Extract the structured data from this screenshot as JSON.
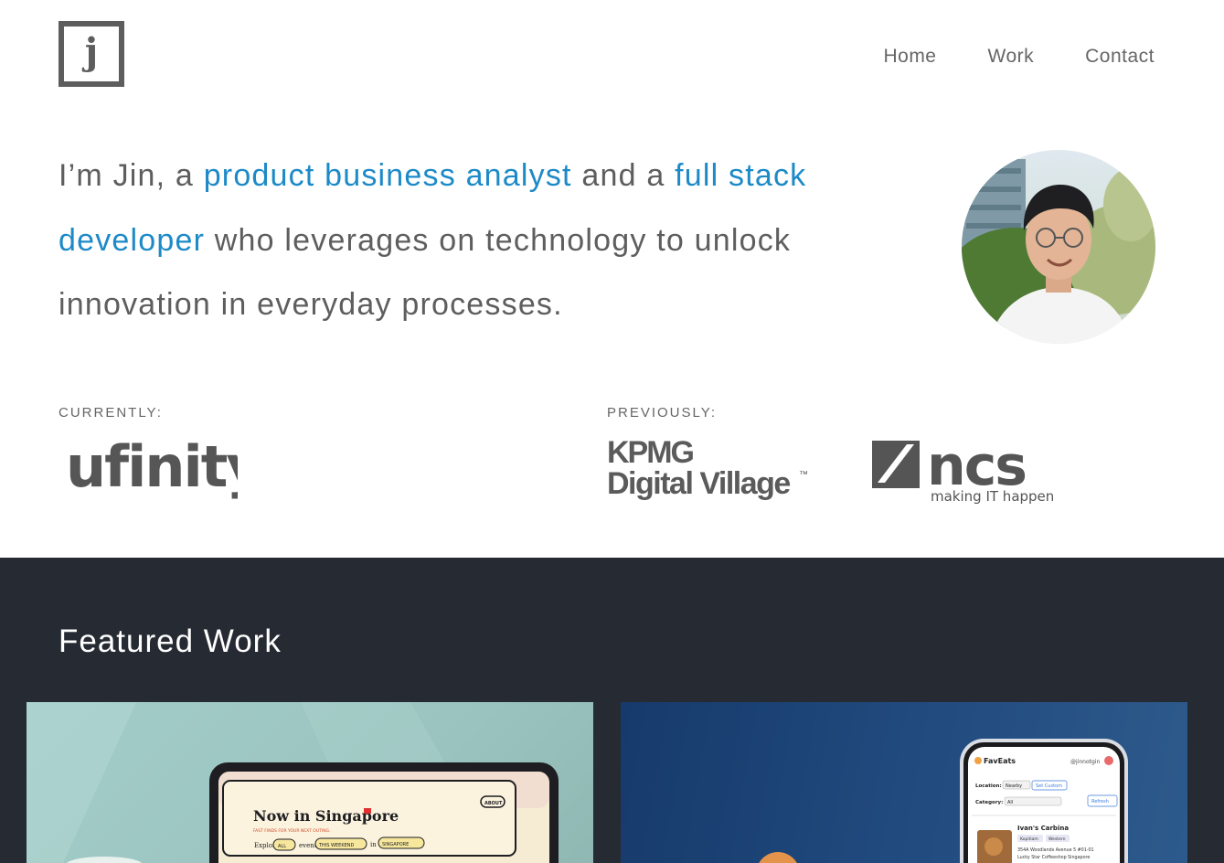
{
  "logo": {
    "letter": "j"
  },
  "nav": {
    "home": "Home",
    "work": "Work",
    "contact": "Contact"
  },
  "intro": {
    "p1": "I’m Jin, a ",
    "h1": "product business analyst",
    "p2": " and a ",
    "h2": "full stack developer",
    "p3": " who leverages on technology to unlock innovation in everyday processes."
  },
  "colors": {
    "accent": "#1d8ac8",
    "dark_section": "#262a33"
  },
  "employers": {
    "currently_label": "CURRENTLY:",
    "previously_label": "PREVIOUSLY:",
    "current": "ufinity",
    "previous": [
      {
        "line1": "KPMG",
        "line2": "Digital Village",
        "tm": "™"
      },
      {
        "name": "ncs",
        "tagline": "making IT happen"
      }
    ]
  },
  "featured": {
    "title": "Featured Work",
    "card1": {
      "headline": "Now in Singapore",
      "subline": "FAST FINDS FOR YOUR NEXT OUTING.",
      "about": "ABOUT",
      "explore": "Explore",
      "filter1": "ALL",
      "events": "events",
      "filter2": "THIS WEEKEND",
      "in": "in",
      "filter3": "SINGAPORE"
    },
    "card2": {
      "app": "FavEats",
      "handle": "@jinnotgin",
      "location_label": "Location:",
      "location_value": "Nearby",
      "set_custom": "Set Custom",
      "category_label": "Category:",
      "category_value": "All",
      "refresh": "Refresh",
      "place": "Ivan's Carbina",
      "tag1": "Kopitiam",
      "tag2": "Western",
      "addr1": "354A Woodlands Avenue 5 #01-01",
      "addr2": "Lucky Star Coffeeshop Singapore"
    }
  }
}
